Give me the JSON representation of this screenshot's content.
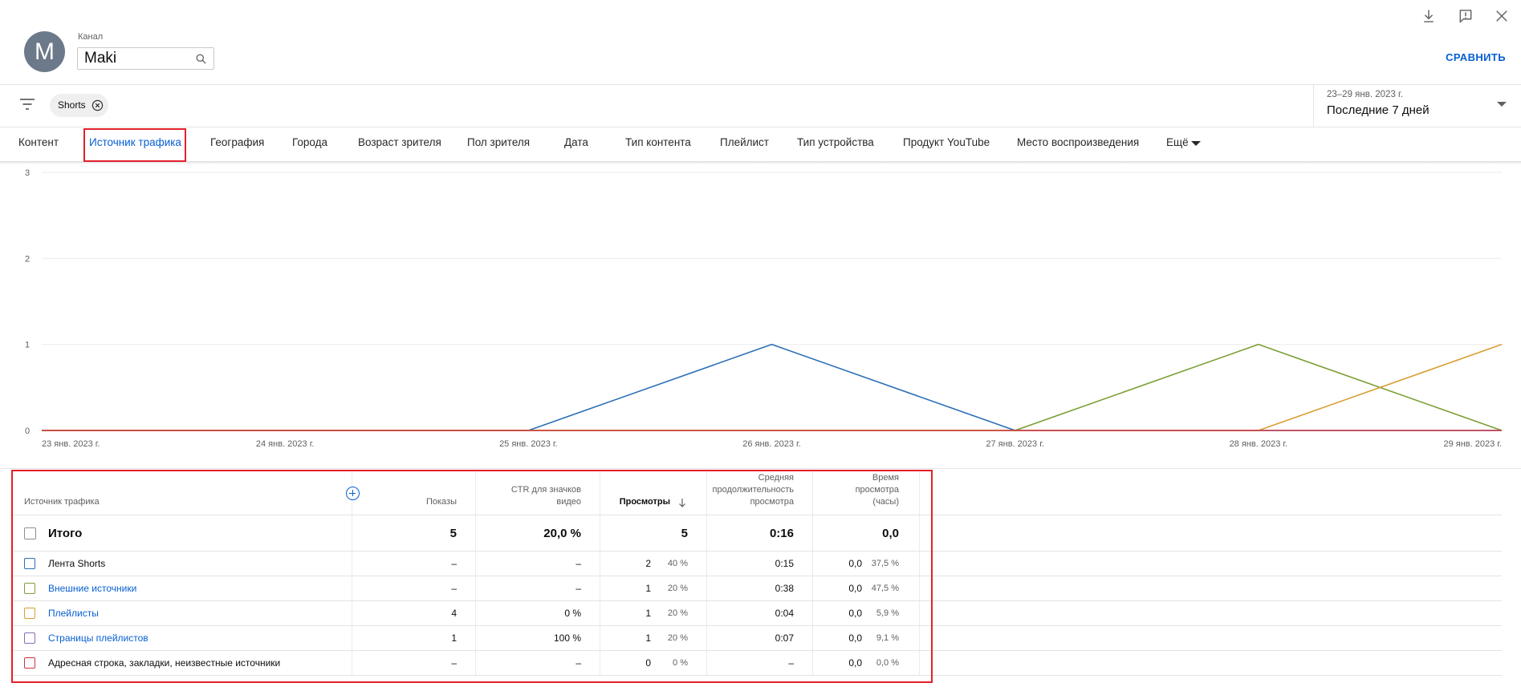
{
  "header": {
    "avatar_letter": "M",
    "channel_label": "Канал",
    "search_value": "Maki",
    "compare_label": "СРАВНИТЬ",
    "icons": [
      "download-icon",
      "feedback-icon",
      "close-icon",
      "search-icon"
    ]
  },
  "filters": {
    "chip_label": "Shorts"
  },
  "date_range": {
    "range": "23–29 янв. 2023 г.",
    "preset": "Последние 7 дней"
  },
  "tabs": [
    "Контент",
    "Источник трафика",
    "География",
    "Города",
    "Возраст зрителя",
    "Пол зрителя",
    "Дата",
    "Тип контента",
    "Плейлист",
    "Тип устройства",
    "Продукт YouTube",
    "Место воспроизведения",
    "Ещё"
  ],
  "active_tab_index": 1,
  "colors": {
    "accent": "#065fd4",
    "highlight_box": "#e3202b"
  },
  "chart_data": {
    "type": "line",
    "x": [
      "23 янв. 2023 г.",
      "24 янв. 2023 г.",
      "25 янв. 2023 г.",
      "26 янв. 2023 г.",
      "27 янв. 2023 г.",
      "28 янв. 2023 г.",
      "29 янв. 2023 г."
    ],
    "ylim": [
      0,
      3
    ],
    "yticks": [
      0,
      1,
      2,
      3
    ],
    "grid": true,
    "series": [
      {
        "legend_row": 0,
        "color": "#2c6fb7",
        "values": [
          0,
          0,
          0,
          1,
          0,
          0,
          0
        ]
      },
      {
        "legend_row": 1,
        "color": "#7c9f35",
        "values": [
          0,
          0,
          0,
          0,
          0,
          1,
          0
        ]
      },
      {
        "legend_row": 2,
        "color": "#d89e32",
        "values": [
          0,
          0,
          0,
          0,
          0,
          0,
          1
        ]
      },
      {
        "legend_row": 4,
        "color": "#cf3340",
        "values": [
          0,
          0,
          0,
          0,
          0,
          0,
          0
        ]
      }
    ]
  },
  "table": {
    "columns": [
      {
        "lines": [
          "Источник трафика"
        ]
      },
      {
        "lines": [
          "Показы"
        ]
      },
      {
        "lines": [
          "CTR для значков",
          "видео"
        ]
      },
      {
        "lines": [
          "Просмотры"
        ]
      },
      {
        "lines": [
          "Средняя",
          "продолжительность",
          "просмотра"
        ]
      },
      {
        "lines": [
          "Время",
          "просмотра",
          "(часы)"
        ]
      }
    ],
    "total": {
      "label": "Итого",
      "impressions": "5",
      "ctr": "20,0 %",
      "views": "5",
      "avg_duration": "0:16",
      "watch_time": "0,0"
    },
    "rows": [
      {
        "name": "Лента Shorts",
        "color": "#2c6fb7",
        "impressions": "–",
        "ctr": "–",
        "views": "2",
        "views_pct": "40 %",
        "avg_duration": "0:15",
        "watch_time": "0,0",
        "watch_time_pct": "37,5 %"
      },
      {
        "name": "Внешние источники",
        "color": "#7c9f35",
        "impressions": "–",
        "ctr": "–",
        "views": "1",
        "views_pct": "20 %",
        "avg_duration": "0:38",
        "watch_time": "0,0",
        "watch_time_pct": "47,5 %"
      },
      {
        "name": "Плейлисты",
        "color": "#d89e32",
        "impressions": "4",
        "ctr": "0 %",
        "views": "1",
        "views_pct": "20 %",
        "avg_duration": "0:04",
        "watch_time": "0,0",
        "watch_time_pct": "5,9 %"
      },
      {
        "name": "Страницы плейлистов",
        "color": "#8b6bb9",
        "impressions": "1",
        "ctr": "100 %",
        "views": "1",
        "views_pct": "20 %",
        "avg_duration": "0:07",
        "watch_time": "0,0",
        "watch_time_pct": "9,1 %"
      },
      {
        "name": "Адресная строка, закладки, неизвестные источники",
        "color": "#cf3340",
        "impressions": "–",
        "ctr": "–",
        "views": "0",
        "views_pct": "0 %",
        "avg_duration": "–",
        "watch_time": "0,0",
        "watch_time_pct": "0,0 %"
      }
    ]
  }
}
